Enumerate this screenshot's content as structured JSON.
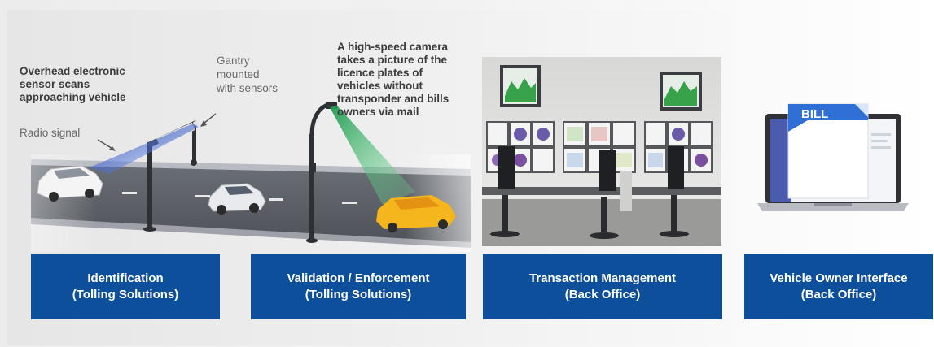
{
  "scene": {
    "overhead_label": [
      "Overhead electronic",
      "sensor scans",
      "approaching vehicle"
    ],
    "radio_label": "Radio signal",
    "gantry_label": [
      "Gantry",
      "mounted",
      "with sensors"
    ],
    "camera_label": [
      "A high-speed camera",
      "takes a picture of the",
      "licence plates of",
      "vehicles without",
      "transponder and bills",
      "owners via mail"
    ],
    "bill_text": "BILL"
  },
  "captions": [
    {
      "line1": "Identification",
      "line2": "(Tolling Solutions)"
    },
    {
      "line1": "Validation / Enforcement",
      "line2": "(Tolling Solutions)"
    },
    {
      "line1": "Transaction Management",
      "line2": "(Back Office)"
    },
    {
      "line1": "Vehicle Owner Interface",
      "line2": "(Back Office)"
    }
  ],
  "colors": {
    "caption_blue": "#0e4f9c",
    "road": "#5d6168",
    "signal_blue": "#2d55c8",
    "camera_green": "#29a35a",
    "car_yellow": "#f5b51c"
  }
}
